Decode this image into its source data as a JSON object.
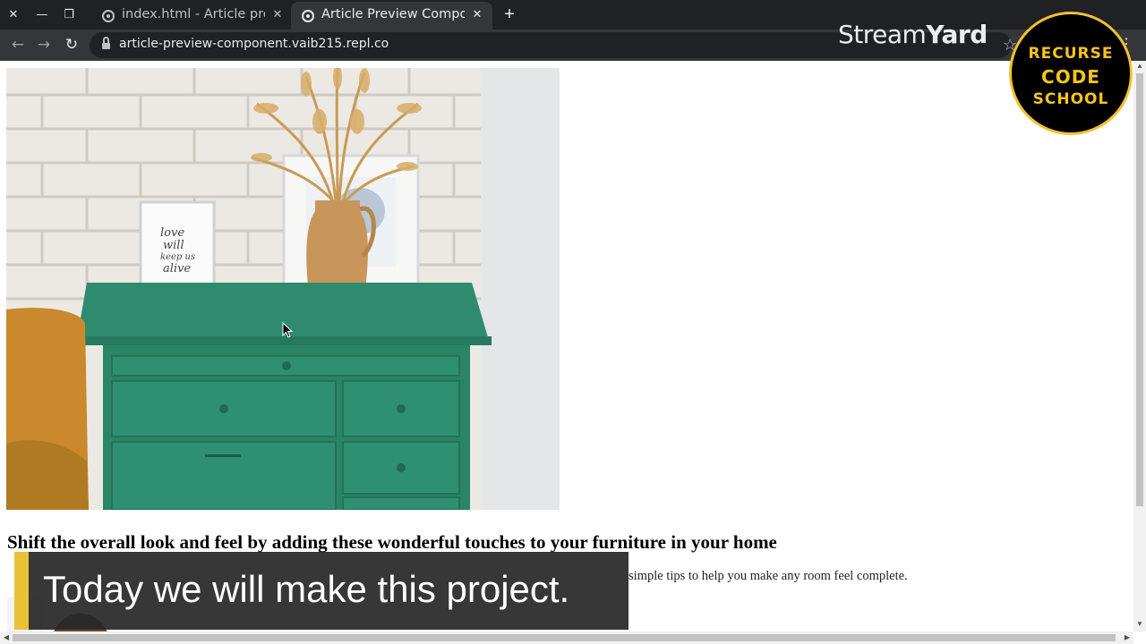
{
  "browser": {
    "tabs": [
      {
        "title": "index.html - Article pre",
        "active": false
      },
      {
        "title": "Article Preview Compon",
        "active": true
      }
    ],
    "url": "article-preview-component.vaib215.repl.co"
  },
  "page": {
    "hero_image_alt": "green dresser with vase of dried grass",
    "poster_text": "love will keep us alive",
    "title": "Shift the overall look and feel by adding these wonderful touches to your furniture in your home",
    "description_visible_end": "simple tips to help you make any room feel complete."
  },
  "overlays": {
    "streamyard_logo": {
      "light": "Stream",
      "bold": "Yard"
    },
    "school_badge": [
      "RECURSE",
      "CODE",
      "SCHOOL"
    ],
    "caption": "Today we will make this project."
  },
  "colors": {
    "dresser_green": "#2e8b6e",
    "caption_accent": "#e8c33a",
    "badge_gold": "#f5c518"
  }
}
